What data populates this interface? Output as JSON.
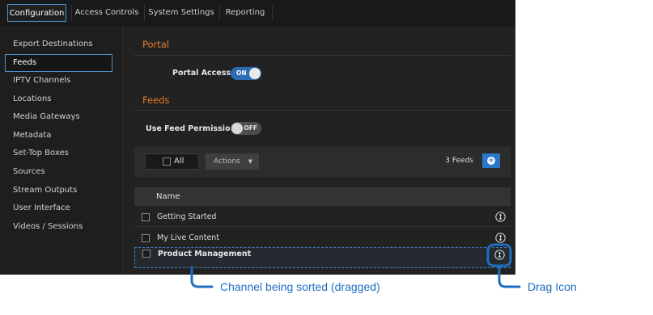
{
  "nav": {
    "tabs": [
      {
        "label": "Configuration",
        "active": true
      },
      {
        "label": "Access Controls",
        "active": false
      },
      {
        "label": "System Settings",
        "active": false
      },
      {
        "label": "Reporting",
        "active": false
      }
    ]
  },
  "sidebar": {
    "items": [
      {
        "label": "Export Destinations"
      },
      {
        "label": "Feeds",
        "active": true
      },
      {
        "label": "IPTV Channels"
      },
      {
        "label": "Locations"
      },
      {
        "label": "Media Gateways"
      },
      {
        "label": "Metadata"
      },
      {
        "label": "Set-Top Boxes"
      },
      {
        "label": "Sources"
      },
      {
        "label": "Stream Outputs"
      },
      {
        "label": "User Interface"
      },
      {
        "label": "Videos / Sessions"
      }
    ]
  },
  "portal": {
    "title": "Portal",
    "access_label": "Portal Access",
    "access_toggle": "ON"
  },
  "feeds": {
    "title": "Feeds",
    "permission_label": "Use Feed Permission",
    "permission_toggle": "OFF",
    "toolbar": {
      "all_label": "All",
      "actions_label": "Actions",
      "count_label": "3 Feeds",
      "add_icon": "plus-circle-icon"
    },
    "table": {
      "column_name": "Name",
      "rows": [
        {
          "name": "Getting Started"
        },
        {
          "name": "My Live Content"
        },
        {
          "name": "Product Management",
          "dragging": true
        }
      ]
    }
  },
  "callouts": {
    "dragged": "Channel being sorted (dragged)",
    "drag_icon": "Drag Icon"
  },
  "colors": {
    "accent": "#2a76c9",
    "section_title": "#e07b2a",
    "callout": "#1e6fbf",
    "background": "#222222"
  }
}
